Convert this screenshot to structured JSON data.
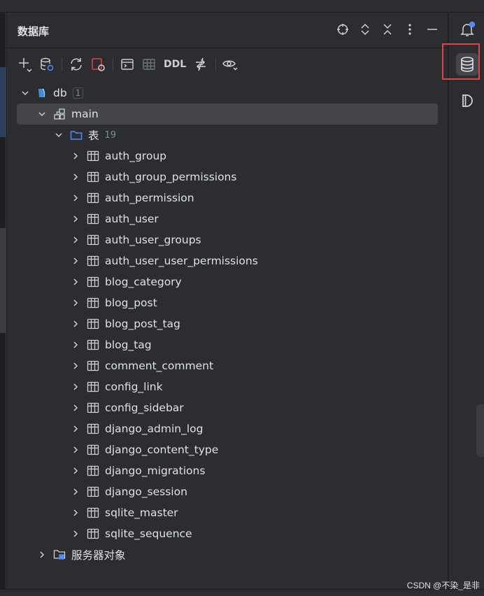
{
  "panel": {
    "title": "数据库"
  },
  "toolbar": {
    "ddl_label": "DDL"
  },
  "tree": {
    "db": {
      "label": "db",
      "count": "1"
    },
    "schema": {
      "label": "main"
    },
    "tables_folder": {
      "label": "表",
      "count": "19"
    },
    "tables": [
      "auth_group",
      "auth_group_permissions",
      "auth_permission",
      "auth_user",
      "auth_user_groups",
      "auth_user_user_permissions",
      "blog_category",
      "blog_post",
      "blog_post_tag",
      "blog_tag",
      "comment_comment",
      "config_link",
      "config_sidebar",
      "django_admin_log",
      "django_content_type",
      "django_migrations",
      "django_session",
      "sqlite_master",
      "sqlite_sequence"
    ],
    "server_objects": {
      "label": "服务器对象"
    }
  },
  "watermark": "CSDN @不染_是非",
  "colors": {
    "accent_blue": "#548af7",
    "highlight_red": "#e04545",
    "selected_bg": "#43454a"
  }
}
